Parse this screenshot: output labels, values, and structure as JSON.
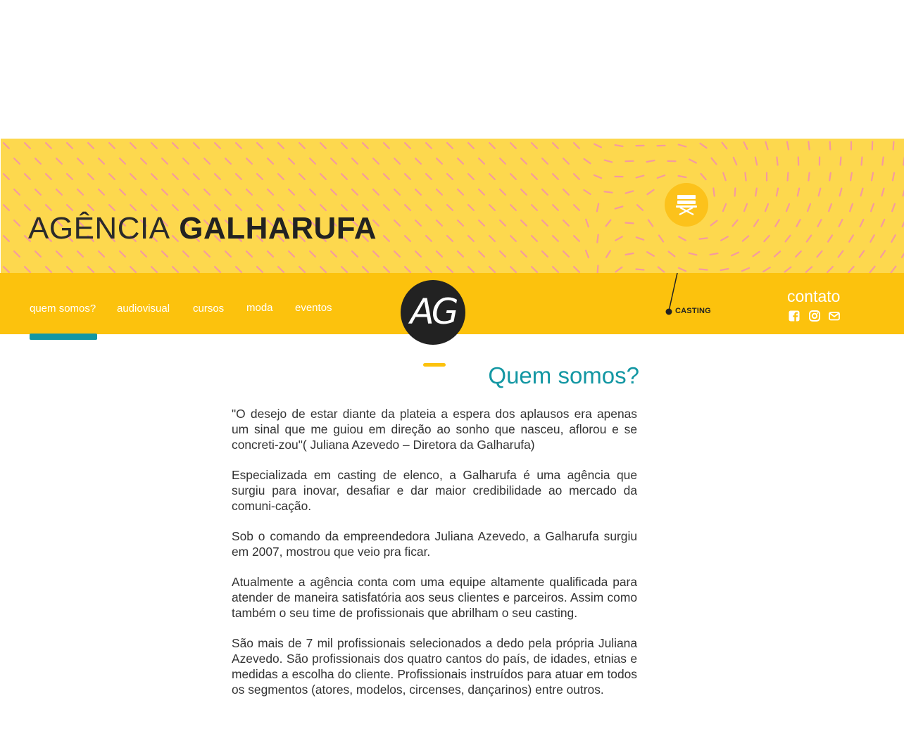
{
  "brand": {
    "light": "AGÊNCIA",
    "bold": "GALHARUFA"
  },
  "nav": {
    "items": [
      "quem somos?",
      "audiovisual",
      "cursos",
      "moda",
      "eventos"
    ],
    "active": "quem somos?"
  },
  "logo": {
    "text": "AG"
  },
  "casting": {
    "label": "CASTING",
    "icon": "director-chair-icon"
  },
  "contact": {
    "title": "contato",
    "icons": [
      "facebook-icon",
      "instagram-icon",
      "mail-icon"
    ]
  },
  "section": {
    "title": "Quem somos?"
  },
  "paragraphs": [
    "\"O desejo de estar diante da plateia a espera dos aplausos era apenas um sinal que me guiou em direção ao sonho que nasceu, aflorou e se concreti-zou\"( Juliana Azevedo – Diretora da Galharufa)",
    "Especializada em casting de elenco, a Galharufa é uma agência que surgiu para inovar, desafiar e dar maior credibilidade ao mercado da comuni-cação.",
    "Sob o comando da empreendedora Juliana Azevedo, a Galharufa surgiu em 2007, mostrou que veio pra ficar.",
    "Atualmente a agência conta com uma equipe altamente qualificada para atender de maneira satisfatória aos seus clientes e parceiros. Assim como também o seu time de profissionais que abrilham o seu casting.",
    "São mais de 7 mil profissionais selecionados a dedo pela própria Juliana Azevedo. São profissionais dos quatro cantos do país, de idades, etnias e medidas a escolha do cliente. Profissionais instruídos para atuar em todos os segmentos (atores, modelos, circenses, dançarinos) entre outros."
  ],
  "colors": {
    "hero_bg": "#fdd84e",
    "nav_bg": "#fcc20d",
    "accent_teal": "#1397a3",
    "pattern_pink": "#f59aa0",
    "dark": "#222222"
  }
}
